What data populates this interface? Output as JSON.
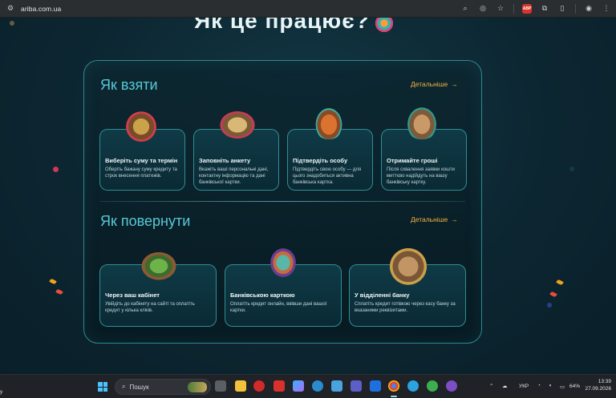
{
  "browser": {
    "url": "ariba.com.ua"
  },
  "hero": {
    "title": "Як це працює?"
  },
  "sections": {
    "take": {
      "title": "Як взяти",
      "details": "Детальніше",
      "cards": [
        {
          "title": "Виберіть суму та термін",
          "text": "Оберіть бажану суму кредиту та строк внесення платежів."
        },
        {
          "title": "Заповніть анкету",
          "text": "Вкажіть ваші персональні дані, контактну інформацію та дані банківської картки."
        },
        {
          "title": "Підтвердіть особу",
          "text": "Підтвердіть свою особу — для цього знадобиться активна банківська картка."
        },
        {
          "title": "Отримайте гроші",
          "text": "Після схвалення заявки кошти миттєво надійдуть на вашу банківську картку."
        }
      ]
    },
    "return": {
      "title": "Як повернути",
      "details": "Детальніше",
      "cards": [
        {
          "title": "Через ваш кабінет",
          "text": "Увійдіть до кабінету на сайті та оплатіть кредит у кілька кліків."
        },
        {
          "title": "Банківською карткою",
          "text": "Оплатіть кредит онлайн, ввівши дані вашої картки."
        },
        {
          "title": "У відділенні банку",
          "text": "Сплатіть кредит готівкою через касу банку за вказаними реквізитами."
        }
      ]
    }
  },
  "taskbar": {
    "search_placeholder": "Пошук",
    "language": "УКР",
    "battery": "64%",
    "time": "13:39",
    "date": "27.09.2026",
    "left_edge": "y"
  },
  "colors": {
    "accent_cyan": "#57c9d6",
    "accent_orange": "#f3b33c",
    "background": "#0b2430"
  }
}
